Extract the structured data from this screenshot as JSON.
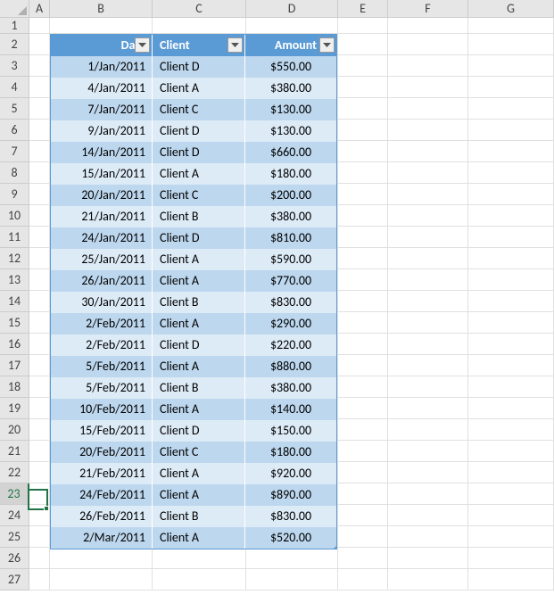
{
  "columns": [
    "A",
    "B",
    "C",
    "D",
    "E",
    "F",
    "G"
  ],
  "column_widths_class": [
    "wA",
    "wB",
    "wC",
    "wD",
    "wE",
    "wF",
    "wG"
  ],
  "row_count": 27,
  "active_row": 23,
  "table": {
    "headers": {
      "date": "Date",
      "client": "Client",
      "amount": "Amount"
    },
    "rows": [
      {
        "date": "1/Jan/2011",
        "client": "Client D",
        "amount": "$550.00"
      },
      {
        "date": "4/Jan/2011",
        "client": "Client A",
        "amount": "$380.00"
      },
      {
        "date": "7/Jan/2011",
        "client": "Client C",
        "amount": "$130.00"
      },
      {
        "date": "9/Jan/2011",
        "client": "Client D",
        "amount": "$130.00"
      },
      {
        "date": "14/Jan/2011",
        "client": "Client D",
        "amount": "$660.00"
      },
      {
        "date": "15/Jan/2011",
        "client": "Client A",
        "amount": "$180.00"
      },
      {
        "date": "20/Jan/2011",
        "client": "Client C",
        "amount": "$200.00"
      },
      {
        "date": "21/Jan/2011",
        "client": "Client B",
        "amount": "$380.00"
      },
      {
        "date": "24/Jan/2011",
        "client": "Client D",
        "amount": "$810.00"
      },
      {
        "date": "25/Jan/2011",
        "client": "Client A",
        "amount": "$590.00"
      },
      {
        "date": "26/Jan/2011",
        "client": "Client A",
        "amount": "$770.00"
      },
      {
        "date": "30/Jan/2011",
        "client": "Client B",
        "amount": "$830.00"
      },
      {
        "date": "2/Feb/2011",
        "client": "Client A",
        "amount": "$290.00"
      },
      {
        "date": "2/Feb/2011",
        "client": "Client D",
        "amount": "$220.00"
      },
      {
        "date": "5/Feb/2011",
        "client": "Client A",
        "amount": "$880.00"
      },
      {
        "date": "5/Feb/2011",
        "client": "Client B",
        "amount": "$380.00"
      },
      {
        "date": "10/Feb/2011",
        "client": "Client A",
        "amount": "$140.00"
      },
      {
        "date": "15/Feb/2011",
        "client": "Client D",
        "amount": "$150.00"
      },
      {
        "date": "20/Feb/2011",
        "client": "Client C",
        "amount": "$180.00"
      },
      {
        "date": "21/Feb/2011",
        "client": "Client A",
        "amount": "$920.00"
      },
      {
        "date": "24/Feb/2011",
        "client": "Client A",
        "amount": "$890.00"
      },
      {
        "date": "26/Feb/2011",
        "client": "Client B",
        "amount": "$830.00"
      },
      {
        "date": "2/Mar/2011",
        "client": "Client A",
        "amount": "$520.00"
      }
    ]
  }
}
